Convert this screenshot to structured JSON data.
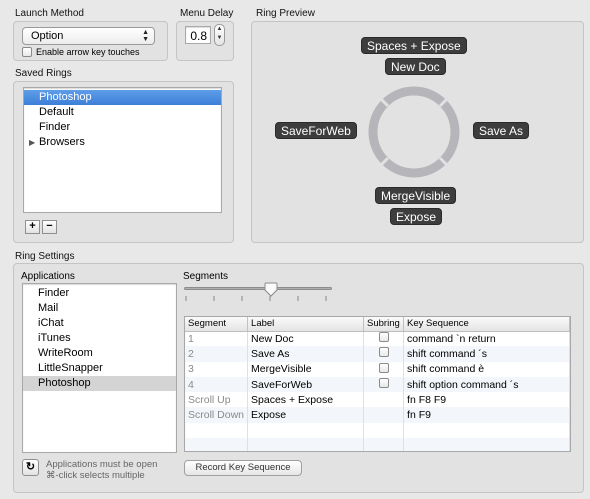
{
  "launch_method": {
    "section_label": "Launch Method",
    "selected": "Option",
    "checkbox_label": "Enable arrow key touches"
  },
  "menu_delay": {
    "section_label": "Menu Delay",
    "value": "0.8"
  },
  "ring_preview": {
    "section_label": "Ring Preview",
    "labels": {
      "top_sub": "Spaces + Expose",
      "top": "New Doc",
      "left": "SaveForWeb",
      "right": "Save As",
      "bottom": "MergeVisible",
      "bottom_sub": "Expose"
    }
  },
  "saved_rings": {
    "section_label": "Saved Rings",
    "items": [
      {
        "label": "Photoshop",
        "selected": true
      },
      {
        "label": "Default"
      },
      {
        "label": "Finder"
      },
      {
        "label": "Browsers",
        "disclosure": true
      }
    ],
    "add_label": "+",
    "remove_label": "−"
  },
  "ring_settings": {
    "section_label": "Ring Settings",
    "applications": {
      "header": "Applications",
      "items": [
        "Finder",
        "Mail",
        "iChat",
        "iTunes",
        "WriteRoom",
        "LittleSnapper",
        "Photoshop"
      ],
      "selected_index": 6,
      "note_line1": "Applications must be open",
      "note_line2": "⌘-click selects multiple"
    },
    "segments": {
      "label": "Segments",
      "columns": [
        "Segment",
        "Label",
        "Subring",
        "Key Sequence"
      ],
      "rows": [
        {
          "segment": "1",
          "label": "New Doc",
          "subring": true,
          "keys": "command `n return"
        },
        {
          "segment": "2",
          "label": "Save As",
          "subring": true,
          "keys": "shift command ´s"
        },
        {
          "segment": "3",
          "label": "MergeVisible",
          "subring": true,
          "keys": "shift command è"
        },
        {
          "segment": "4",
          "label": "SaveForWeb",
          "subring": true,
          "keys": "shift option command ´s"
        },
        {
          "segment": "Scroll Up",
          "label": "Spaces + Expose",
          "subring": false,
          "keys": "fn F8 F9"
        },
        {
          "segment": "Scroll Down",
          "label": "Expose",
          "subring": false,
          "keys": "fn F9"
        }
      ],
      "record_button": "Record Key Sequence"
    }
  }
}
